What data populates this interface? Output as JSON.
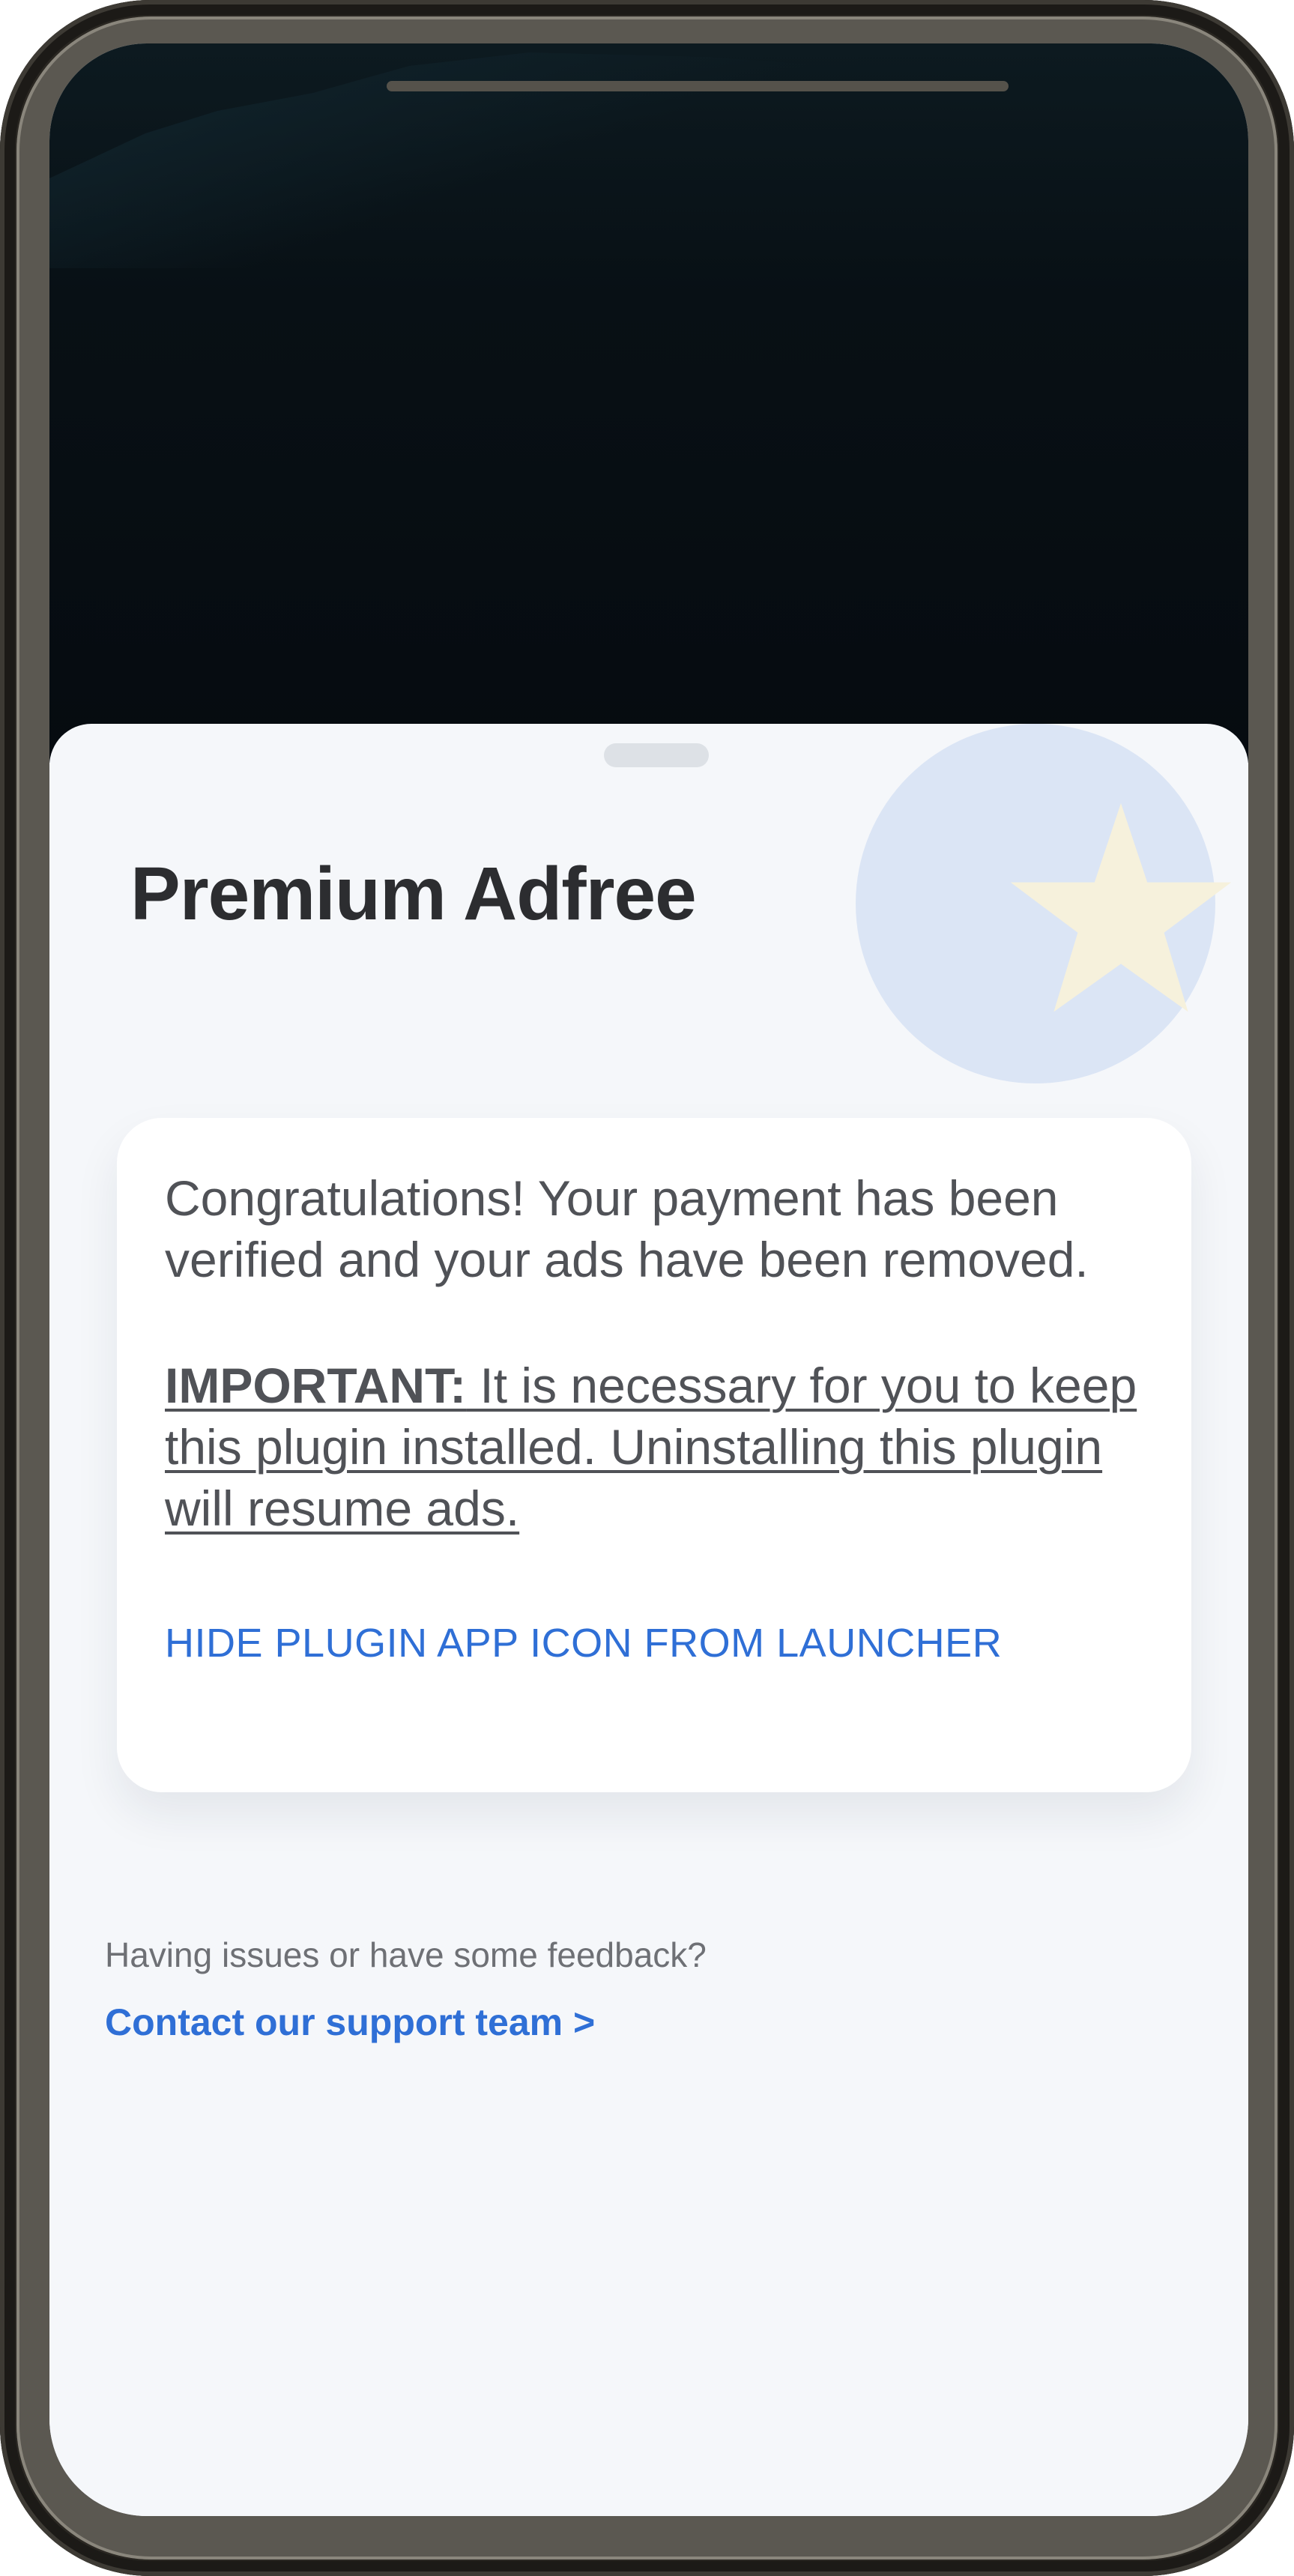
{
  "sheet": {
    "title": "Premium Adfree",
    "badge_icon": "star-badge-icon"
  },
  "card": {
    "message": "Congratulations! Your payment has been verified and your ads have been removed.",
    "important_label": "IMPORTANT:",
    "important_text": " It is necessary for you to keep this plugin installed. Uninstalling this plugin will resume ads.",
    "hide_icon_link": "HIDE PLUGIN APP ICON FROM LAUNCHER"
  },
  "support": {
    "prompt": "Having issues or have some feedback?",
    "link": "Contact our support team >"
  },
  "colors": {
    "accent": "#2f6fd6",
    "title": "#2c2d30",
    "body_text": "#505257",
    "sheet_bg": "#f5f7fa",
    "badge_circle": "#dbe5f5",
    "badge_star": "#f6f1dc"
  }
}
